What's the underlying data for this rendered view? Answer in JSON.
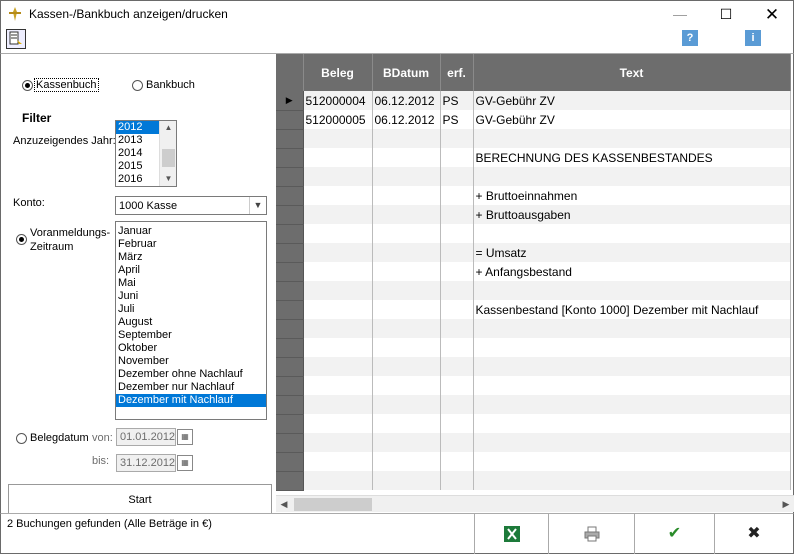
{
  "window": {
    "title": "Kassen-/Bankbuch anzeigen/drucken",
    "min_glyph": "—",
    "max_glyph": "☐",
    "close_glyph": "✕"
  },
  "toolbar": {
    "print_icon": "print-preview-icon",
    "help_label": "?",
    "info_label": "i"
  },
  "book_type": {
    "options": [
      "Kassenbuch",
      "Bankbuch"
    ],
    "selected": "Kassenbuch"
  },
  "filter": {
    "heading": "Filter",
    "year_label": "Anzuzeigendes Jahr:",
    "years": [
      "2012",
      "2013",
      "2014",
      "2015",
      "2016"
    ],
    "selected_year": "2012",
    "konto_label": "Konto:",
    "konto_value": "1000 Kasse",
    "period_radio_label_1": "Voranmeldungs-",
    "period_radio_label_2": "Zeitraum",
    "periods": [
      "Januar",
      "Februar",
      "März",
      "April",
      "Mai",
      "Juni",
      "Juli",
      "August",
      "September",
      "Oktober",
      "November",
      "Dezember ohne Nachlauf",
      "Dezember nur Nachlauf",
      "Dezember mit Nachlauf"
    ],
    "selected_period": "Dezember mit Nachlauf",
    "belegdatum_label": "Belegdatum",
    "von_label": "von:",
    "bis_label": "bis:",
    "von_value": "01.01.2012",
    "bis_value": "31.12.2012"
  },
  "start_label": "Start",
  "grid": {
    "columns": [
      "Beleg",
      "BDatum",
      "erf.",
      "Text"
    ],
    "rows": [
      [
        "512000004",
        "06.12.2012",
        "PS",
        "GV-Gebühr ZV"
      ],
      [
        "512000005",
        "06.12.2012",
        "PS",
        "GV-Gebühr ZV"
      ],
      [
        "",
        "",
        "",
        ""
      ],
      [
        "",
        "",
        "",
        "BERECHNUNG DES KASSENBESTANDES"
      ],
      [
        "",
        "",
        "",
        ""
      ],
      [
        "",
        "",
        "",
        "+ Bruttoeinnahmen"
      ],
      [
        "",
        "",
        "",
        "+ Bruttoausgaben"
      ],
      [
        "",
        "",
        "",
        ""
      ],
      [
        "",
        "",
        "",
        "= Umsatz"
      ],
      [
        "",
        "",
        "",
        "+ Anfangsbestand"
      ],
      [
        "",
        "",
        "",
        ""
      ],
      [
        "",
        "",
        "",
        "Kassenbestand [Konto 1000] Dezember mit Nachlauf"
      ],
      [
        "",
        "",
        "",
        ""
      ],
      [
        "",
        "",
        "",
        ""
      ],
      [
        "",
        "",
        "",
        ""
      ],
      [
        "",
        "",
        "",
        ""
      ],
      [
        "",
        "",
        "",
        ""
      ],
      [
        "",
        "",
        "",
        ""
      ],
      [
        "",
        "",
        "",
        ""
      ],
      [
        "",
        "",
        "",
        ""
      ],
      [
        "",
        "",
        "",
        ""
      ]
    ]
  },
  "status": {
    "message": "2 Buchungen gefunden  (Alle Beträge in €)",
    "excel_icon": "excel-icon",
    "print_icon": "printer-icon",
    "ok_glyph": "✔",
    "cancel_glyph": "✖"
  }
}
